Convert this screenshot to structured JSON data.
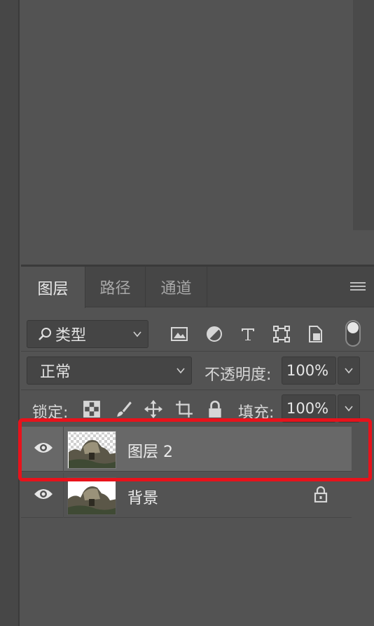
{
  "tabs": [
    {
      "label": "图层",
      "active": true
    },
    {
      "label": "路径",
      "active": false
    },
    {
      "label": "通道",
      "active": false
    }
  ],
  "filter": {
    "selected": "类型"
  },
  "filter_icons": [
    "image-filter-icon",
    "adjustment-filter-icon",
    "type-filter-icon",
    "shape-filter-icon",
    "smart-object-filter-icon"
  ],
  "blend_mode": {
    "selected": "正常"
  },
  "opacity": {
    "label": "不透明度:",
    "value": "100%"
  },
  "lock": {
    "label": "锁定:"
  },
  "fill": {
    "label": "填充:",
    "value": "100%"
  },
  "layers": [
    {
      "name": "图层 2",
      "selected": true,
      "visible": true,
      "locked": false
    },
    {
      "name": "背景",
      "selected": false,
      "visible": true,
      "locked": true
    }
  ],
  "colors": {
    "highlight": "#e8121b",
    "panel": "#535353",
    "selected_row": "#686868"
  }
}
